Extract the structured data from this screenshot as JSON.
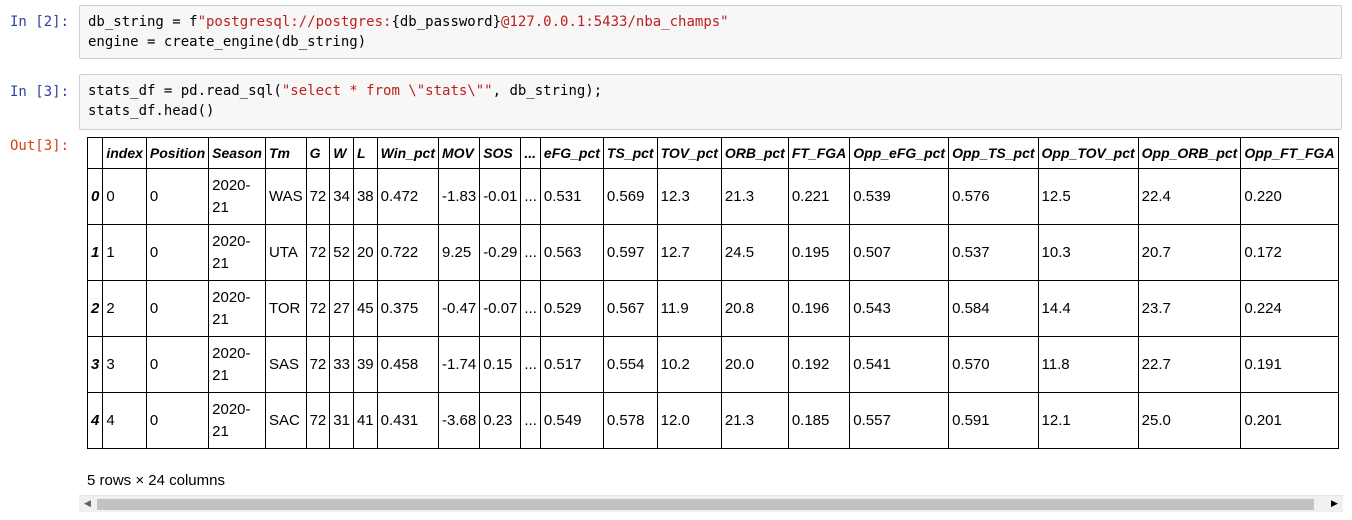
{
  "cells": [
    {
      "prompt": "In [2]:",
      "code": [
        [
          "db_string = f",
          {
            "s": "\"postgresql://postgres:"
          },
          "{db_password}",
          {
            "s": "@127.0.0.1:5433/nba_champs\""
          }
        ],
        [
          "engine = create_engine(db_string)"
        ]
      ]
    },
    {
      "prompt": "In [3]:",
      "code": [
        [
          "stats_df = pd.read_sql(",
          {
            "s": "\"select * from \\\"stats\\\"\""
          },
          ", db_string);"
        ],
        [
          "stats_df.head()"
        ]
      ]
    }
  ],
  "output": {
    "prompt": "Out[3]:",
    "columns": [
      "",
      "index",
      "Position",
      "Season",
      "Tm",
      "G",
      "W",
      "L",
      "Win_pct",
      "MOV",
      "SOS",
      "...",
      "eFG_pct",
      "TS_pct",
      "TOV_pct",
      "ORB_pct",
      "FT_FGA",
      "Opp_eFG_pct",
      "Opp_TS_pct",
      "Opp_TOV_pct",
      "Opp_ORB_pct",
      "Opp_FT_FGA"
    ],
    "rows": [
      [
        "0",
        "0",
        "0",
        "2020-21",
        "WAS",
        "72",
        "34",
        "38",
        "0.472",
        "-1.83",
        "-0.01",
        "...",
        "0.531",
        "0.569",
        "12.3",
        "21.3",
        "0.221",
        "0.539",
        "0.576",
        "12.5",
        "22.4",
        "0.220"
      ],
      [
        "1",
        "1",
        "0",
        "2020-21",
        "UTA",
        "72",
        "52",
        "20",
        "0.722",
        "9.25",
        "-0.29",
        "...",
        "0.563",
        "0.597",
        "12.7",
        "24.5",
        "0.195",
        "0.507",
        "0.537",
        "10.3",
        "20.7",
        "0.172"
      ],
      [
        "2",
        "2",
        "0",
        "2020-21",
        "TOR",
        "72",
        "27",
        "45",
        "0.375",
        "-0.47",
        "-0.07",
        "...",
        "0.529",
        "0.567",
        "11.9",
        "20.8",
        "0.196",
        "0.543",
        "0.584",
        "14.4",
        "23.7",
        "0.224"
      ],
      [
        "3",
        "3",
        "0",
        "2020-21",
        "SAS",
        "72",
        "33",
        "39",
        "0.458",
        "-1.74",
        "0.15",
        "...",
        "0.517",
        "0.554",
        "10.2",
        "20.0",
        "0.192",
        "0.541",
        "0.570",
        "11.8",
        "22.7",
        "0.191"
      ],
      [
        "4",
        "4",
        "0",
        "2020-21",
        "SAC",
        "72",
        "31",
        "41",
        "0.431",
        "-3.68",
        "0.23",
        "...",
        "0.549",
        "0.578",
        "12.0",
        "21.3",
        "0.185",
        "0.557",
        "0.591",
        "12.1",
        "25.0",
        "0.201"
      ]
    ],
    "summary": "5 rows × 24 columns"
  },
  "scrollbar": {
    "left_arrow": "◀",
    "right_arrow": "▶",
    "position_fraction": 0.0
  },
  "colors": {
    "in_prompt": "#303f9f",
    "out_prompt": "#d84315",
    "string": "#ba2121",
    "cell_bg": "#f7f7f7"
  }
}
